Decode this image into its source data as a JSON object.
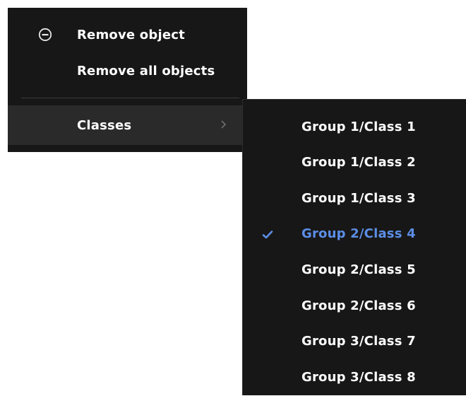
{
  "context_menu": {
    "items": [
      {
        "label": "Remove object",
        "icon": "minus-circle-icon"
      },
      {
        "label": "Remove all objects"
      }
    ],
    "classes": {
      "label": "Classes",
      "icon": "chevron-right-icon"
    }
  },
  "classes_submenu": {
    "items": [
      {
        "label": "Group 1/Class 1"
      },
      {
        "label": "Group 1/Class 2"
      },
      {
        "label": "Group 1/Class 3"
      },
      {
        "label": "Group 2/Class 4",
        "selected": true,
        "icon": "checkmark-icon"
      },
      {
        "label": "Group 2/Class 5"
      },
      {
        "label": "Group 2/Class 6"
      },
      {
        "label": "Group 3/Class 7"
      },
      {
        "label": "Group 3/Class 8"
      }
    ]
  },
  "colors": {
    "menu_background": "#171717",
    "hover_background": "#2a2a2a",
    "text": "#ffffff",
    "accent": "#5c8ee6"
  }
}
